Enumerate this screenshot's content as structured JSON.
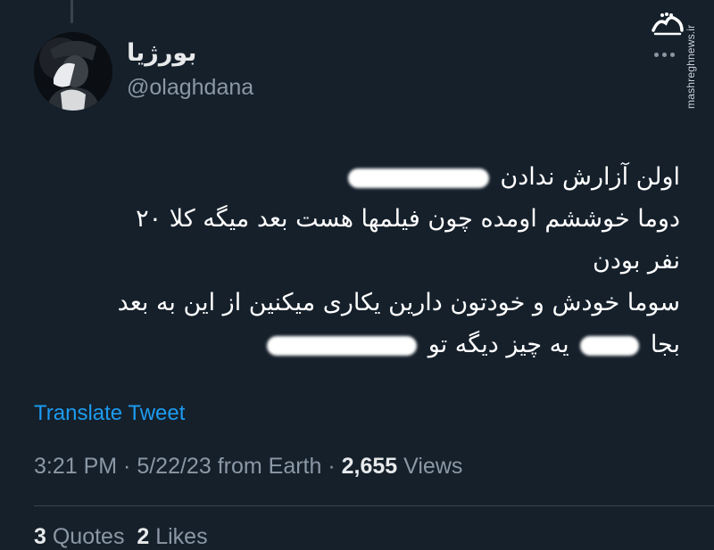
{
  "user": {
    "display_name": "بورژیا",
    "handle": "@olaghdana"
  },
  "watermark": {
    "logo_text": "مشرق",
    "url": "mashreghnews.ir"
  },
  "tweet": {
    "line1_text": "اولن آزارش ندادن",
    "line2_text": "دوما خوششم اومده چون فیلمها هست بعد میگه کلا ۲۰",
    "line3_text": "نفر بودن",
    "line4_text": "سوما خودش و خودتون دارین یکاری میکنین از این به بعد",
    "line5_part1": "بجا",
    "line5_part2": "یه چیز دیگه تو"
  },
  "translate_label": "Translate Tweet",
  "meta": {
    "time": "3:21 PM",
    "sep1": " · ",
    "date": "5/22/23",
    "source": " from Earth",
    "sep2": " · ",
    "views_count": "2,655",
    "views_label": " Views"
  },
  "stats": {
    "quotes_count": "3",
    "quotes_label": " Quotes",
    "likes_count": "2",
    "likes_label": " Likes"
  },
  "colors": {
    "background": "#15202b",
    "link": "#1d9bf0",
    "secondary": "#8b98a5"
  },
  "icons": {
    "more": "more-horizontal-icon"
  }
}
